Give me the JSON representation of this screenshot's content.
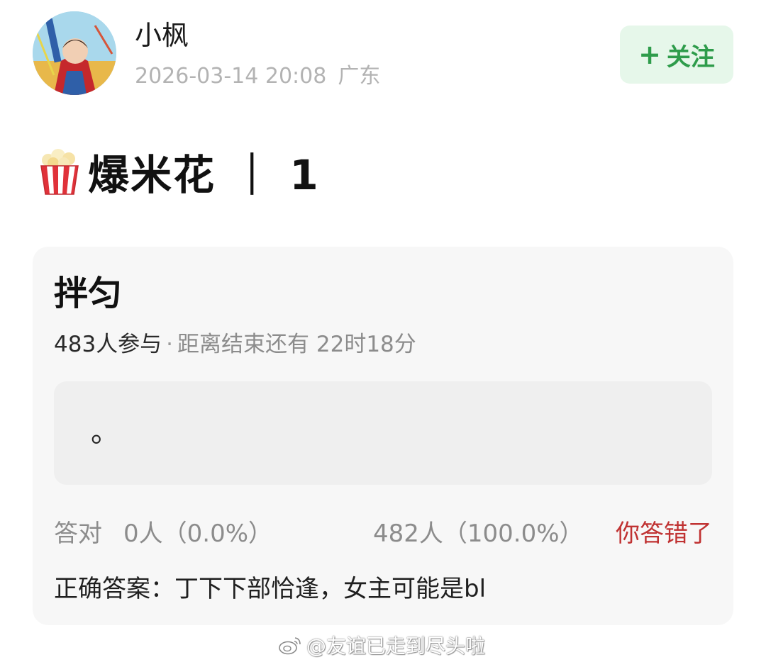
{
  "author": {
    "name": "小枫",
    "timestamp": "2026-03-14 20:08",
    "location": "广东",
    "avatar_icon": "avatar-photo"
  },
  "follow": {
    "plus": "+",
    "label": "关注",
    "color": "#2e9c4b",
    "background": "#e6f7ea"
  },
  "post": {
    "emoji_icon": "popcorn-icon",
    "title": "爆米花 ｜ 1"
  },
  "quiz": {
    "title": "拌匀",
    "participants": "483人参与",
    "separator": "·",
    "remaining": "距离结束还有 22时18分",
    "option_text": "。",
    "correct_label": "答对",
    "correct_count": "0人（0.0%）",
    "wrong_count": "482人（100.0%）",
    "result": "你答错了",
    "result_color": "#c03232",
    "answer_line": "正确答案：丁下下部恰逢，女主可能是bl"
  },
  "watermark": {
    "icon": "weibo-icon",
    "text": "@友谊已走到尽头啦"
  }
}
